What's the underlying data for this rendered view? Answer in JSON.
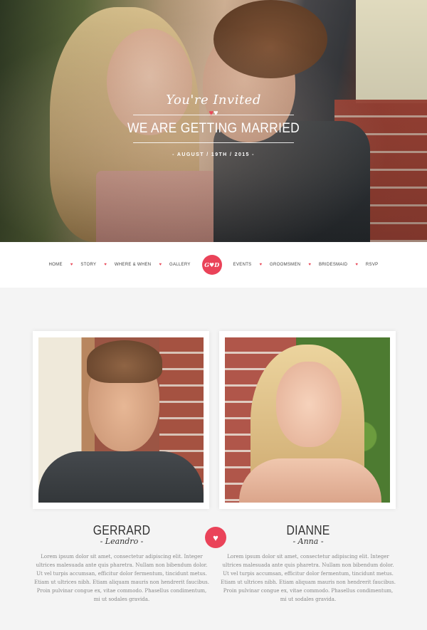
{
  "hero": {
    "invite_text": "You're Invited",
    "headline": "WE ARE GETTING MARRIED",
    "date": "- AUGUST / 19TH / 2015 -"
  },
  "nav": {
    "items_left": [
      "HOME",
      "STORY",
      "WHERE & WHEN",
      "GALLERY"
    ],
    "logo": "G♥D",
    "items_right": [
      "EVENTS",
      "GROOMSMEN",
      "BRIDESMAID",
      "RSVP"
    ]
  },
  "couple": {
    "groom": {
      "name": "GERRARD",
      "nickname": "- Leandro -",
      "bio": "Lorem ipsum dolor sit amet, consectetur adipiscing elit. Integer ultrices malesuada ante quis pharetra. Nullam non bibendum dolor. Ut vel turpis accumsan, efficitur dolor fermentum, tincidunt metus. Etiam ut ultrices nibh. Etiam aliquam mauris non hendrerit faucibus. Proin pulvinar congue ex, vitae commodo. Phasellus condimentum, mi ut sodales gravida."
    },
    "bride": {
      "name": "DIANNE",
      "nickname": "- Anna -",
      "bio": "Lorem ipsum dolor sit amet, consectetur adipiscing elit. Integer ultrices malesuada ante quis pharetra. Nullam non bibendum dolor. Ut vel turpis accumsan, efficitur dolor fermentum, tincidunt metus. Etiam ut ultrices nibh. Etiam aliquam mauris non hendrerit faucibus. Proin pulvinar congue ex, vitae commodo. Phasellus condimentum, mi ut sodales gravida."
    }
  },
  "colors": {
    "accent": "#ea4359",
    "background": "#f4f4f4",
    "text_dark": "#333333",
    "text_muted": "#888888"
  },
  "icons": {
    "heart": "heart-icon"
  }
}
